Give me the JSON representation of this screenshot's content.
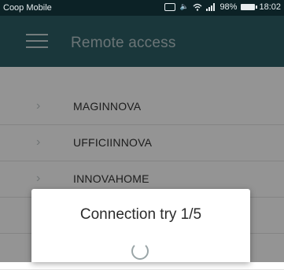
{
  "status_bar": {
    "carrier": "Coop Mobile",
    "battery": "98%",
    "time": "18:02",
    "icons": [
      "nfc-icon",
      "mute-icon",
      "wifi-icon",
      "signal-icon",
      "battery-icon"
    ]
  },
  "app_bar": {
    "title": "Remote access",
    "menu_icon": "menu-icon",
    "color": "#2e5f66"
  },
  "list": {
    "items": [
      {
        "label": "MAGINNOVA"
      },
      {
        "label": "UFFICIINNOVA"
      },
      {
        "label": "INNOVAHOME"
      },
      {
        "label": ""
      },
      {
        "label": ""
      }
    ],
    "chevron_icon": "chevron-right-icon"
  },
  "dialog": {
    "title": "Connection try 1/5",
    "spinner_icon": "loading-spinner-icon"
  }
}
